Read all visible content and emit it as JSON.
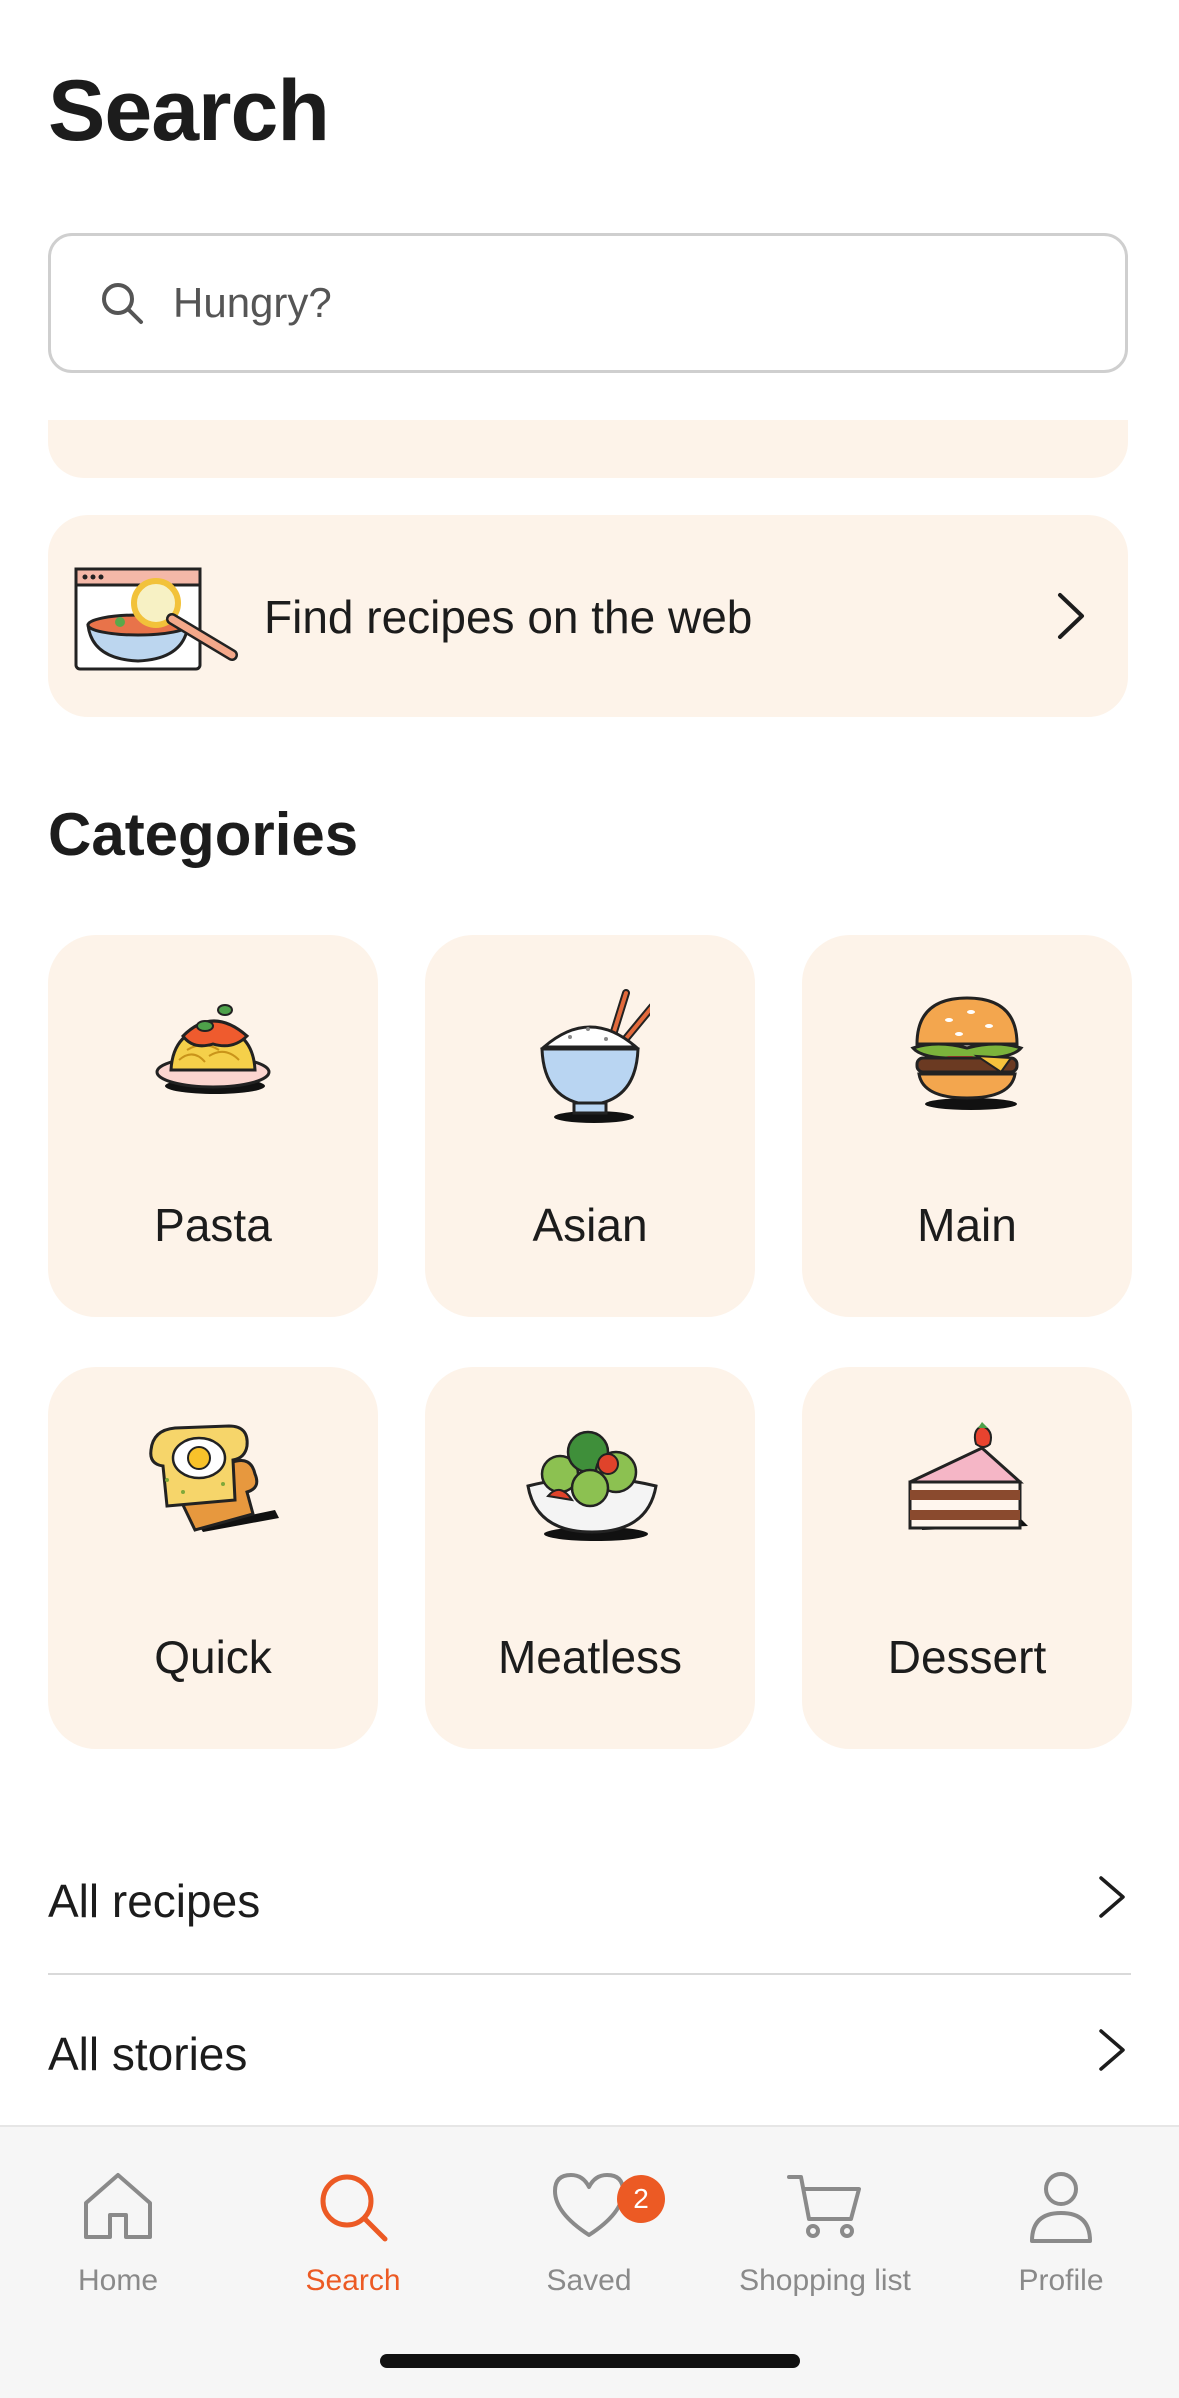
{
  "header": {
    "title": "Search"
  },
  "search": {
    "placeholder": "Hungry?"
  },
  "web_card": {
    "label": "Find recipes on the web"
  },
  "categories": {
    "title": "Categories",
    "items": [
      {
        "label": "Pasta",
        "icon": "pasta-icon"
      },
      {
        "label": "Asian",
        "icon": "rice-bowl-icon"
      },
      {
        "label": "Main",
        "icon": "burger-icon"
      },
      {
        "label": "Quick",
        "icon": "toast-egg-icon"
      },
      {
        "label": "Meatless",
        "icon": "salad-icon"
      },
      {
        "label": "Dessert",
        "icon": "cake-icon"
      }
    ]
  },
  "links": [
    {
      "label": "All recipes"
    },
    {
      "label": "All stories"
    }
  ],
  "tabbar": {
    "items": [
      {
        "label": "Home",
        "icon": "home-icon"
      },
      {
        "label": "Search",
        "icon": "search-icon",
        "active": true
      },
      {
        "label": "Saved",
        "icon": "heart-icon",
        "badge": "2"
      },
      {
        "label": "Shopping list",
        "icon": "cart-icon"
      },
      {
        "label": "Profile",
        "icon": "person-icon"
      }
    ]
  },
  "colors": {
    "accent": "#ec5a24",
    "card_background": "#fdf3e9",
    "inactive_tab": "#8a8a8a"
  }
}
